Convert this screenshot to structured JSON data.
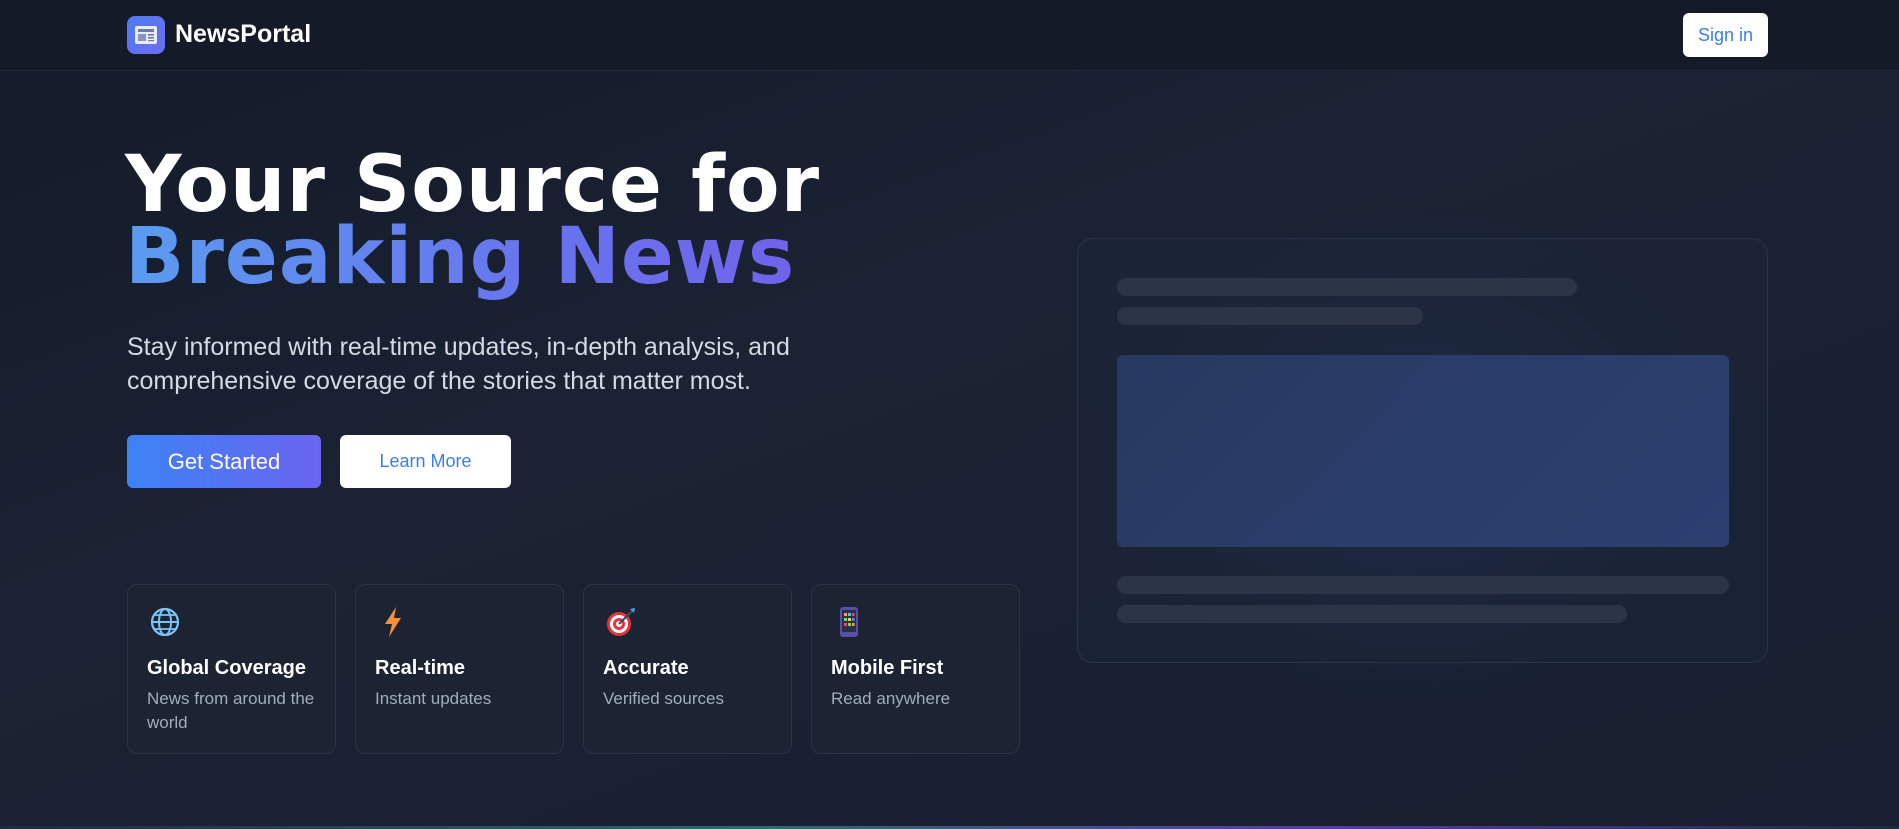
{
  "header": {
    "brand": "NewsPortal",
    "sign_in_label": "Sign in"
  },
  "hero": {
    "title_line1": "Your Source for",
    "title_line2": "Breaking News",
    "subtitle": "Stay informed with real-time updates, in-depth analysis, and comprehensive coverage of the stories that matter most.",
    "primary_button": "Get Started",
    "secondary_button": "Learn More"
  },
  "features": [
    {
      "icon": "globe-icon",
      "title": "Global Coverage",
      "desc": "News from around the world"
    },
    {
      "icon": "lightning-icon",
      "title": "Real-time",
      "desc": "Instant updates"
    },
    {
      "icon": "target-icon",
      "title": "Accurate",
      "desc": "Verified sources"
    },
    {
      "icon": "mobile-icon",
      "title": "Mobile First",
      "desc": "Read anywhere"
    }
  ],
  "colors": {
    "accent_blue": "#3c82f5",
    "accent_purple": "#6a65f0",
    "background": "#161d2d",
    "link_blue": "#3b7fe0"
  }
}
